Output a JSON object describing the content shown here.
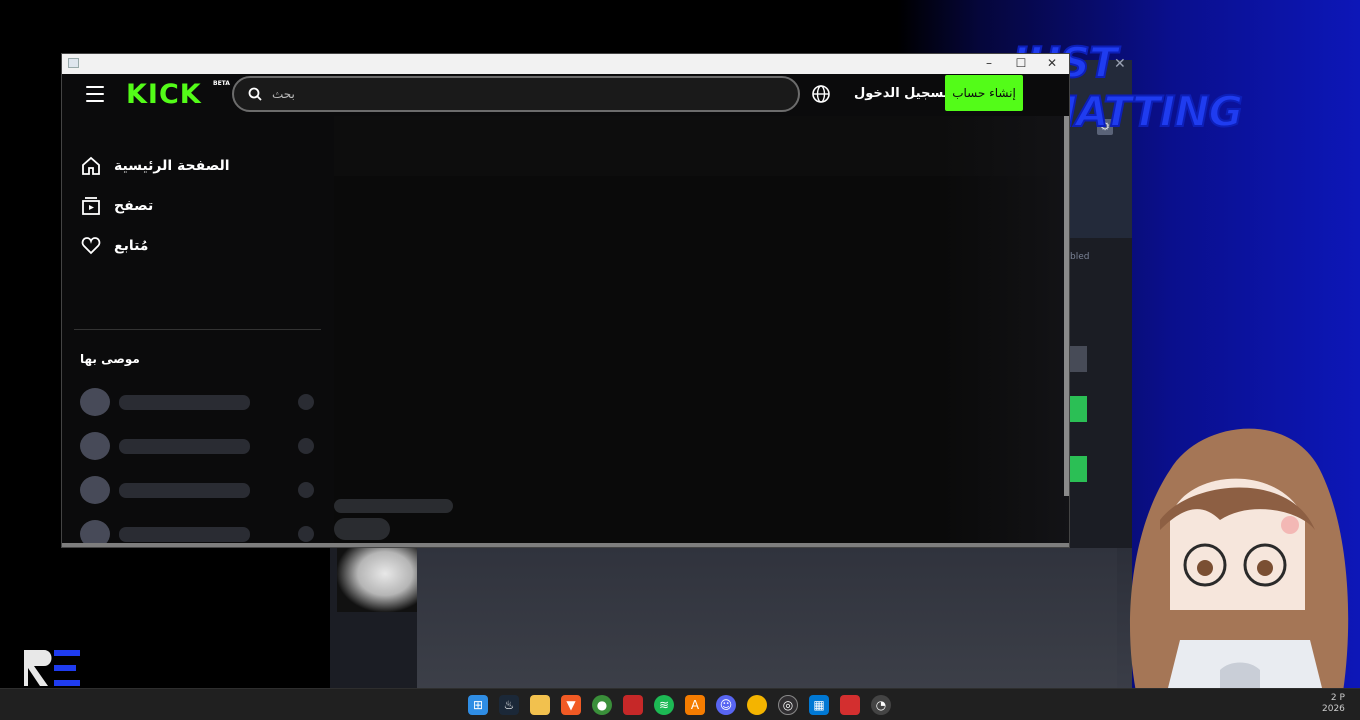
{
  "window": {
    "titlebar": {
      "minimize": "–",
      "maximize": "☐",
      "close": "✕"
    }
  },
  "header": {
    "logo": "KICK",
    "beta_badge": "BETA",
    "search_placeholder": "بحث",
    "login_label": "تسجيل الدخول",
    "signup_label": "إنشاء حساب"
  },
  "sidebar": {
    "items": [
      {
        "label": "الصفحة الرئيسية",
        "icon": "home-icon"
      },
      {
        "label": "تصفح",
        "icon": "browse-icon"
      },
      {
        "label": "مُتابع",
        "icon": "heart-icon"
      }
    ],
    "recommended_title": "موصى بها"
  },
  "background": {
    "brand_title": "JUST CHATTING",
    "tiny_text": "bled"
  },
  "colors": {
    "kick_green": "#53fc18",
    "brand_blue": "#1f3cf0",
    "skeleton": "#2a2c33",
    "avatar_skeleton": "#474a58"
  },
  "taskbar": {
    "icons": [
      "windows-start-icon",
      "steam-icon",
      "file-explorer-icon",
      "brave-icon",
      "chrome-icon",
      "app-red-icon",
      "spotify-icon",
      "app-orange-icon",
      "discord-icon",
      "app-yellow-icon",
      "obs-icon",
      "store-icon",
      "app-red2-icon",
      "app-tray-icon"
    ],
    "clock_line1": "2 P",
    "clock_line2": "2026"
  }
}
